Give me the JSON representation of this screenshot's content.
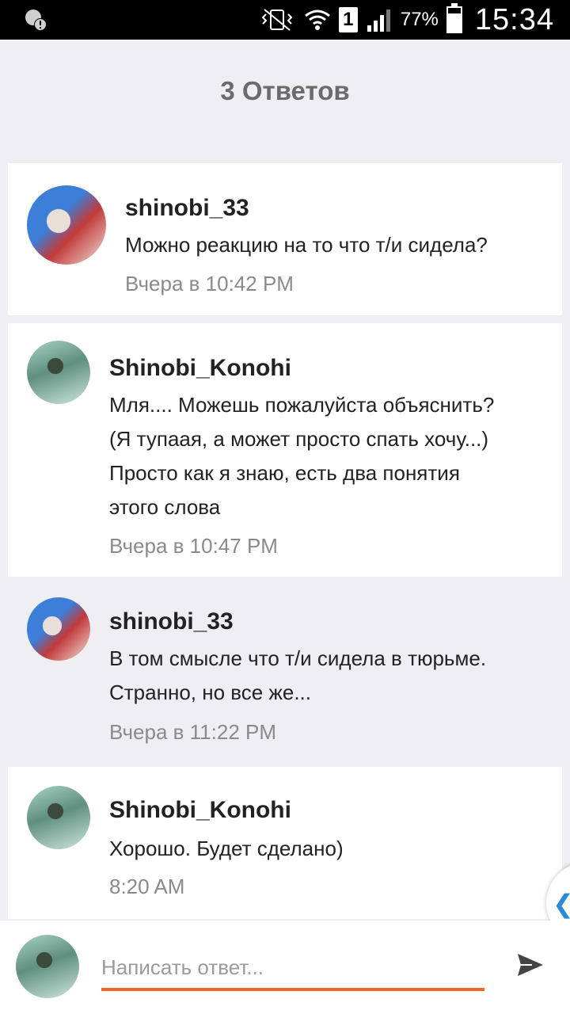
{
  "status_bar": {
    "battery": "77%",
    "battery_level": 0.77,
    "sim": "1",
    "time": "15:34"
  },
  "header": {
    "title": "3 Ответов"
  },
  "comments": [
    {
      "username": "shinobi_33",
      "lines": [
        "Можно реакцию на то что т/и сидела?"
      ],
      "time": "Вчера в 10:42 PM"
    },
    {
      "username": "Shinobi_Konohi",
      "lines": [
        "Мля.... Можешь пожалуйста объяснить?",
        "(Я тупаая, а может просто спать хочу...)",
        "Просто как я знаю, есть два понятия",
        "этого слова"
      ],
      "time": "Вчера в 10:47 PM"
    },
    {
      "username": "shinobi_33",
      "lines": [
        "В том смысле что т/и сидела в тюрьме.",
        "Странно, но все же..."
      ],
      "time": "Вчера в 11:22 PM"
    },
    {
      "username": "Shinobi_Konohi",
      "lines": [
        "Хорошо. Будет сделано)"
      ],
      "time": "8:20 AM"
    }
  ],
  "reply": {
    "placeholder": "Написать ответ..."
  },
  "colors": {
    "accent": "#f26522",
    "side_tab_icon": "#2a8ad4"
  },
  "icons": {
    "status_left": "alert-icon",
    "send": "send-icon",
    "side_tab": "chevron-left-icon"
  }
}
